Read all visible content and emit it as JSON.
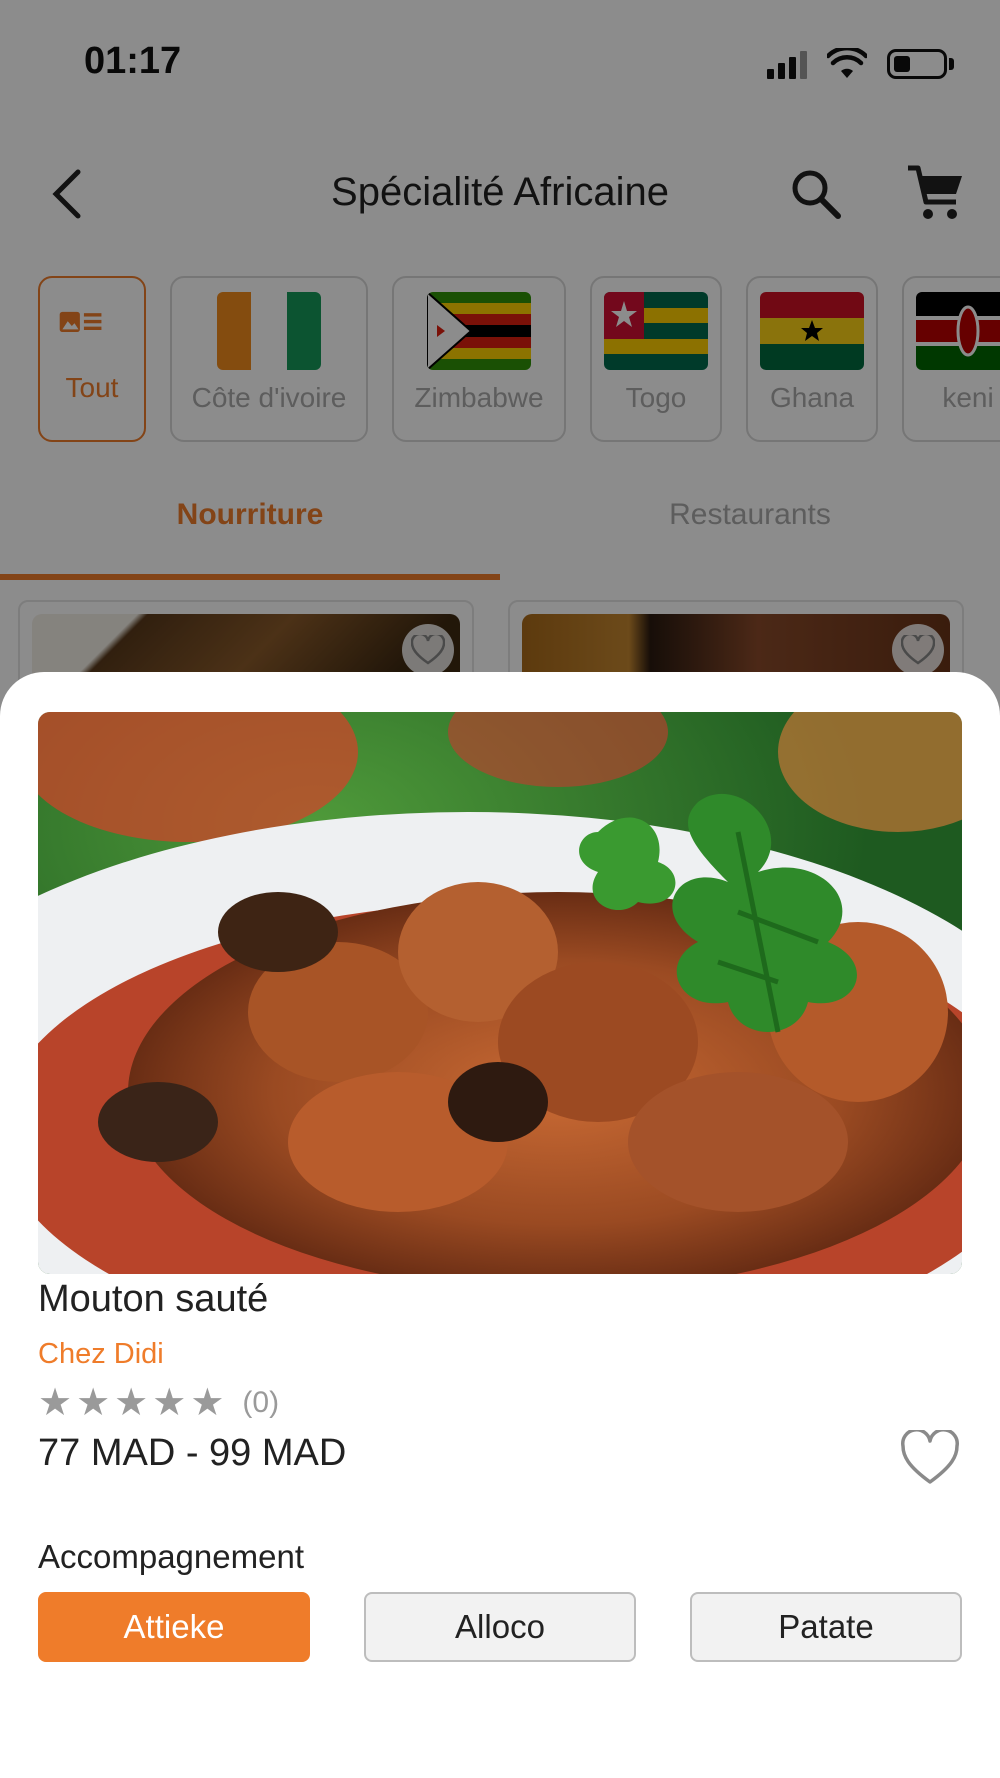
{
  "status_bar": {
    "time": "01:17"
  },
  "header": {
    "title": "Spécialité Africaine"
  },
  "categories": [
    {
      "label": "Tout",
      "active": true
    },
    {
      "label": "Côte d'ivoire"
    },
    {
      "label": "Zimbabwe"
    },
    {
      "label": "Togo"
    },
    {
      "label": "Ghana"
    },
    {
      "label": "keni"
    }
  ],
  "tabs": [
    {
      "label": "Nourriture",
      "active": true
    },
    {
      "label": "Restaurants"
    }
  ],
  "product": {
    "name": "Mouton sauté",
    "restaurant": "Chez Didi",
    "rating_count": "(0)",
    "price": "77 MAD - 99 MAD",
    "section_label": "Accompagnement",
    "options": [
      {
        "label": "Attieke",
        "selected": true
      },
      {
        "label": "Alloco"
      },
      {
        "label": "Patate"
      }
    ]
  },
  "colors": {
    "accent": "#ef7c2a",
    "text": "#222222",
    "muted": "#9a9a9a"
  }
}
